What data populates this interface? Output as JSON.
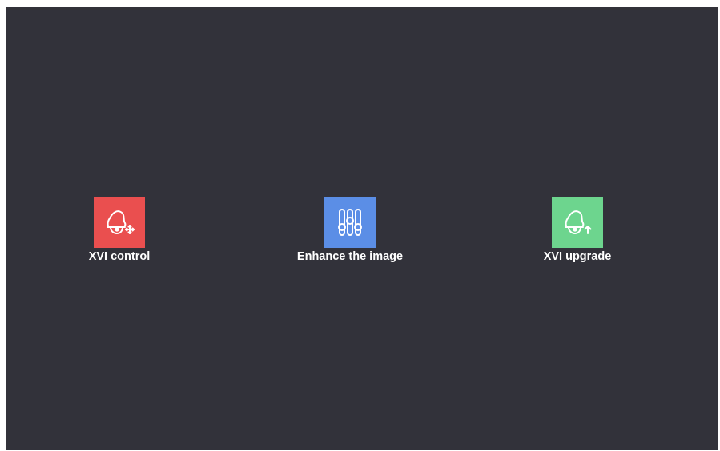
{
  "colors": {
    "background": "#32323a",
    "control_tile": "#ea4f4f",
    "enhance_tile": "#5b8ee6",
    "upgrade_tile": "#6dd58e",
    "label": "#ffffff"
  },
  "tiles": [
    {
      "label": "XVI control",
      "icon": "dome-camera-move-icon",
      "color": "#ea4f4f"
    },
    {
      "label": "Enhance the image",
      "icon": "sliders-icon",
      "color": "#5b8ee6"
    },
    {
      "label": "XVI upgrade",
      "icon": "dome-camera-upgrade-icon",
      "color": "#6dd58e"
    }
  ]
}
